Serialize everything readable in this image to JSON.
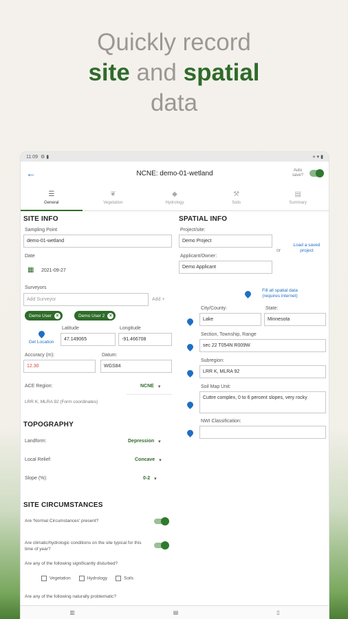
{
  "headline": {
    "line1": "Quickly record",
    "site": "site",
    "and": " and ",
    "spatial": "spatial",
    "line3": "data"
  },
  "status": {
    "time": "11:09",
    "icons_left": "⚙ ▮",
    "icons_right": "⋄ ▾ ▮"
  },
  "appbar": {
    "title": "NCNE: demo-01-wetland",
    "autosave": "Auto save?"
  },
  "tabs": [
    "General",
    "Vegetation",
    "Hydrology",
    "Soils",
    "Summary"
  ],
  "site_info": {
    "title": "SITE INFO",
    "sampling_point_label": "Sampling Point",
    "sampling_point": "demo-01-wetland",
    "date_label": "Date",
    "date": "2021-09-27",
    "surveyors_label": "Surveyors",
    "add_surveyor_placeholder": "Add Surveyor",
    "add_label": "Add +",
    "chips": [
      "Demo User",
      "Demo User 2"
    ],
    "get_location": "Get Location",
    "latitude_label": "Latitude",
    "latitude": "47.149065",
    "longitude_label": "Longitude",
    "longitude": "-91.466708",
    "accuracy_label": "Accuracy (m):",
    "accuracy": "12.30",
    "datum_label": "Datum:",
    "datum": "WGS84",
    "ace_label": "ACE Region:",
    "ace_value": "NCNE",
    "lrr_text": "LRR K, MLRA 92 (Form coordinates)"
  },
  "topography": {
    "title": "TOPOGRAPHY",
    "landform_label": "Landform:",
    "landform": "Depression",
    "relief_label": "Local Relief:",
    "relief": "Concave",
    "slope_label": "Slope (%):",
    "slope": "0-2"
  },
  "circumstances": {
    "title": "SITE CIRCUMSTANCES",
    "q1": "Are 'Normal Circumstances' present?",
    "q2": "Are climatic/hydrologic conditions on the site typical for this time of year?",
    "q3": "Are any of the following significantly disturbed?",
    "options": [
      "Vegetation",
      "Hydrology",
      "Soils"
    ],
    "q4": "Are any of the following naturally problematic?"
  },
  "spatial_info": {
    "title": "SPATIAL INFO",
    "project_label": "Project/site:",
    "project": "Demo Project",
    "or": "or",
    "load_saved": "Load a saved project",
    "applicant_label": "Applicant/Owner:",
    "applicant": "Demo Applicant",
    "fill_all": "Fill all spatial data (requires internet)",
    "city_label": "City/County:",
    "city": "Lake",
    "state_label": "State:",
    "state": "Minnesota",
    "str_label": "Section, Township, Range",
    "str": "sec 22 T054N R009W",
    "subregion_label": "Subregion:",
    "subregion": "LRR K, MLRA 92",
    "soil_label": "Soil Map Unit:",
    "soil": "Cuttre complex, 0 to 6 percent slopes, very rocky",
    "nwi_label": "NWI Classification:",
    "nwi": ""
  },
  "navbar": [
    "▥",
    "▤",
    "▯"
  ]
}
